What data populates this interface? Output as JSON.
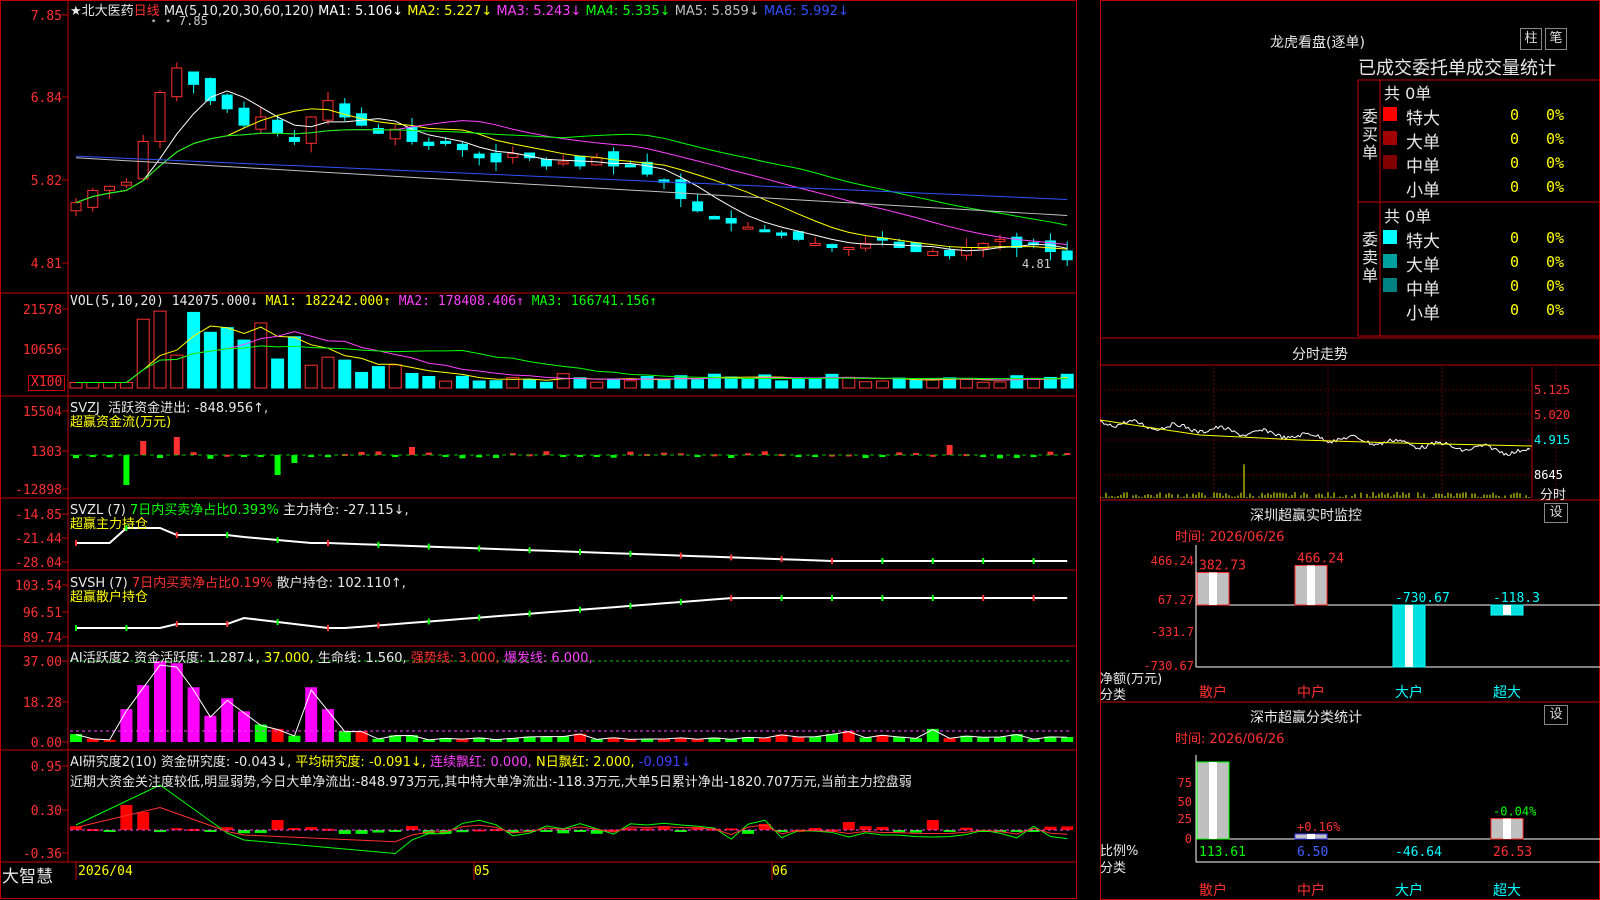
{
  "stock": {
    "title": "★北大医药",
    "period": "日线",
    "price_high_label": "7.85",
    "price_low_label": "4.81",
    "star_marks": "⋆ ⋆"
  },
  "main": {
    "ma_header": "MA(5,10,20,30,60,120)",
    "ma": [
      {
        "label": "MA1: 5.106↓",
        "color": "#ffffff"
      },
      {
        "label": "MA2: 5.227↓",
        "color": "#ffff00"
      },
      {
        "label": "MA3: 5.243↓",
        "color": "#ff40ff"
      },
      {
        "label": "MA4: 5.335↓",
        "color": "#00ff00"
      },
      {
        "label": "MA5: 5.859↓",
        "color": "#c0c0c0"
      },
      {
        "label": "MA6: 5.992↓",
        "color": "#3050ff"
      }
    ],
    "y_ticks": [
      "7.85",
      "6.84",
      "5.82",
      "4.81"
    ]
  },
  "vol": {
    "header": "VOL(5,10,20)",
    "value": "142075.000↓",
    "ma": [
      {
        "label": "MA1: 182242.000↑",
        "color": "#ffff00"
      },
      {
        "label": "MA2: 178408.406↑",
        "color": "#ff40ff"
      },
      {
        "label": "MA3: 166741.156↑",
        "color": "#00ff00"
      }
    ],
    "y_ticks": [
      "21578",
      "10656"
    ],
    "unit": "X100"
  },
  "svzj": {
    "header": "SVZJ",
    "line1": "活跃资金进出: -848.956↑,",
    "line2": "超赢资金流(万元)",
    "y_ticks": [
      "15504",
      "1303",
      "-12898"
    ]
  },
  "svzl": {
    "header": "SVZL (7)",
    "l1": "7日内买卖净占比0.393%",
    "l2": "主力持仓: -27.115↓,",
    "line2": "超赢主力持仓",
    "y_ticks": [
      "-14.85",
      "-21.44",
      "-28.04"
    ]
  },
  "svsh": {
    "header": "SVSH (7)",
    "l1": "7日内买卖净占比0.19%",
    "l2": "散户持仓: 102.110↑,",
    "line2": "超赢散户持仓",
    "y_ticks": [
      "103.54",
      "96.51",
      "89.74"
    ]
  },
  "ai1": {
    "header": "AI活跃度2",
    "l1": "资金活跃度: 1.287↓,",
    "l2": "37.000,",
    "l3": "生命线: 1.560,",
    "l4": "强势线: 3.000,",
    "l5": "爆发线: 6.000,",
    "y_ticks": [
      "37.00",
      "18.28",
      "0.00"
    ]
  },
  "ai2": {
    "header": "AI研究度2(10)",
    "l1": "资金研究度: -0.043↓,",
    "l2": "平均研究度: -0.091↓,",
    "l3": "连续飘红: 0.000,",
    "l4": "N日飘红: 2.000,",
    "l5": "-0.091↓",
    "comment": "近期大资金关注度较低,明显弱势,今日大单净流出:-848.973万元,其中特大单净流出:-118.3万元,大单5日累计净出-1820.707万元,当前主力控盘弱",
    "y_ticks": [
      "0.95",
      "0.30",
      "-0.36"
    ]
  },
  "xaxis": {
    "app": "大智慧",
    "labels": [
      "2026/04",
      "05",
      "06"
    ]
  },
  "dragon": {
    "title": "龙虎看盘(逐单)",
    "btn1": "柱",
    "btn2": "笔",
    "subtitle": "已成交委托单成交量统计",
    "buy": {
      "side": "委买单",
      "total": "共 0单",
      "rows": [
        {
          "name": "特大",
          "val": "0",
          "pct": "0%",
          "color": "#ff0000"
        },
        {
          "name": "大单",
          "val": "0",
          "pct": "0%",
          "color": "#a00000"
        },
        {
          "name": "中单",
          "val": "0",
          "pct": "0%",
          "color": "#800000"
        },
        {
          "name": "小单",
          "val": "0",
          "pct": "0%",
          "color": ""
        }
      ]
    },
    "sell": {
      "side": "委卖单",
      "total": "共 0单",
      "rows": [
        {
          "name": "特大",
          "val": "0",
          "pct": "0%",
          "color": "#00ffff"
        },
        {
          "name": "大单",
          "val": "0",
          "pct": "0%",
          "color": "#00a0a0"
        },
        {
          "name": "中单",
          "val": "0",
          "pct": "0%",
          "color": "#008080"
        },
        {
          "name": "小单",
          "val": "0",
          "pct": "0%",
          "color": ""
        }
      ]
    }
  },
  "intraday": {
    "title": "分时走势",
    "y_ticks": [
      "5.125",
      "5.020",
      "4.915"
    ],
    "vol_tick": "8645",
    "footer": "分时"
  },
  "monitor": {
    "title": "深圳超赢实时监控",
    "set": "设",
    "time": "时间: 2026/06/26",
    "y_ticks": [
      "466.24",
      "67.27",
      "-331.7",
      "-730.67"
    ],
    "ylabel": "净额(万元)",
    "xlabel": "分类",
    "bars": [
      {
        "cat": "散户",
        "value": 382.73,
        "label": "382.73"
      },
      {
        "cat": "中户",
        "value": 466.24,
        "label": "466.24"
      },
      {
        "cat": "大户",
        "value": -730.67,
        "label": "-730.67"
      },
      {
        "cat": "超大",
        "value": -118.3,
        "label": "-118.3"
      }
    ]
  },
  "stats": {
    "title": "深市超赢分类统计",
    "set": "设",
    "time": "时间: 2026/06/26",
    "y_ticks": [
      "75",
      "50",
      "25",
      "0"
    ],
    "ylabel": "比例%",
    "xlabel": "分类",
    "bars": [
      {
        "cat": "散户",
        "value": 113.61,
        "label": "113.61",
        "top": ""
      },
      {
        "cat": "中户",
        "value": 6.5,
        "label": "6.50",
        "top": "+0.16%"
      },
      {
        "cat": "大户",
        "value": -46.64,
        "label": "-46.64",
        "top": ""
      },
      {
        "cat": "超大",
        "value": 26.53,
        "label": "26.53",
        "top": "-0.04%"
      }
    ]
  },
  "colors": {
    "up": "#ff3030",
    "down": "#00ffff",
    "border": "#c00000"
  }
}
